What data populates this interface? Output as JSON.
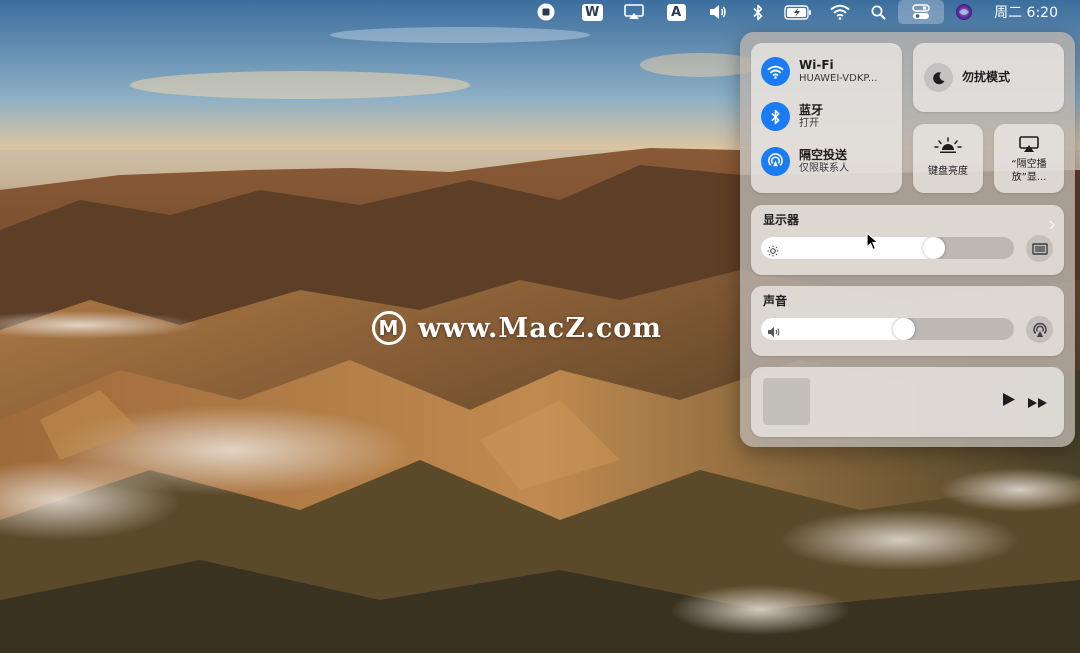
{
  "menubar": {
    "icons": [
      "stop-recording-icon",
      "wps-icon",
      "airplay-display-icon",
      "input-method-icon",
      "volume-icon",
      "bluetooth-icon",
      "battery-icon",
      "wifi-icon",
      "spotlight-search-icon",
      "control-center-icon",
      "siri-icon"
    ],
    "input_method_label": "A",
    "wps_label": "W",
    "clock": "周二 6:20"
  },
  "watermark": {
    "text": "www.MacZ.com",
    "logo_letter": "M"
  },
  "control_center": {
    "network": {
      "wifi": {
        "title": "Wi-Fi",
        "subtitle": "HUAWEI-VDKP...",
        "icon": "wifi-icon",
        "state": "on"
      },
      "bluetooth": {
        "title": "蓝牙",
        "subtitle": "打开",
        "icon": "bluetooth-icon",
        "state": "on"
      },
      "airdrop": {
        "title": "隔空投送",
        "subtitle": "仅限联系人",
        "icon": "airdrop-icon",
        "state": "on"
      }
    },
    "focus": {
      "label": "勿扰模式",
      "icon": "moon-icon"
    },
    "keyboard_brightness": {
      "label": "键盘亮度",
      "icon": "keyboard-brightness-icon"
    },
    "screen_mirroring": {
      "label_line1": "“隔空播",
      "label_line2": "放”显...",
      "icon": "screen-mirroring-icon"
    },
    "display": {
      "title": "显示器",
      "level": 0.7,
      "icon": "sun-icon",
      "button_icon": "display-icon"
    },
    "sound": {
      "title": "声音",
      "level": 0.57,
      "icon": "speaker-icon",
      "button_icon": "airplay-audio-icon"
    },
    "now_playing": {
      "artwork_icon": "album-artwork-placeholder",
      "play_icon": "play-icon",
      "forward_icon": "fast-forward-icon"
    }
  },
  "colors": {
    "accent_blue": "#1a7bf2"
  }
}
